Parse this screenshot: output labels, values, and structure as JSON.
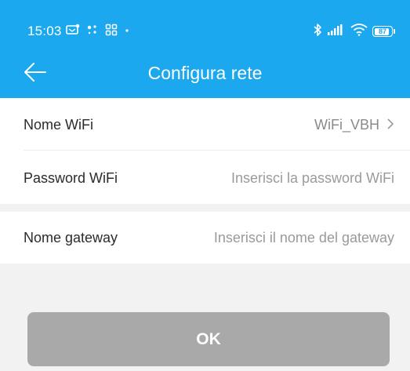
{
  "status_bar": {
    "time": "15:03",
    "battery_level": "87",
    "icons_left": [
      "notification-icon",
      "dots-icon",
      "grid-icon",
      "more-dot-icon"
    ],
    "icons_right": [
      "bluetooth-icon",
      "signal-icon",
      "wifi-icon",
      "battery-icon"
    ]
  },
  "header": {
    "title": "Configura rete",
    "background_color": "#1ba8ee"
  },
  "form": {
    "wifi_name": {
      "label": "Nome WiFi",
      "value": "WiFi_VBH"
    },
    "wifi_password": {
      "label": "Password WiFi",
      "placeholder": "Inserisci la password WiFi"
    },
    "gateway_name": {
      "label": "Nome gateway",
      "placeholder": "Inserisci il nome del gateway"
    }
  },
  "ok_button": {
    "label": "OK",
    "color": "#a9a9a9"
  }
}
